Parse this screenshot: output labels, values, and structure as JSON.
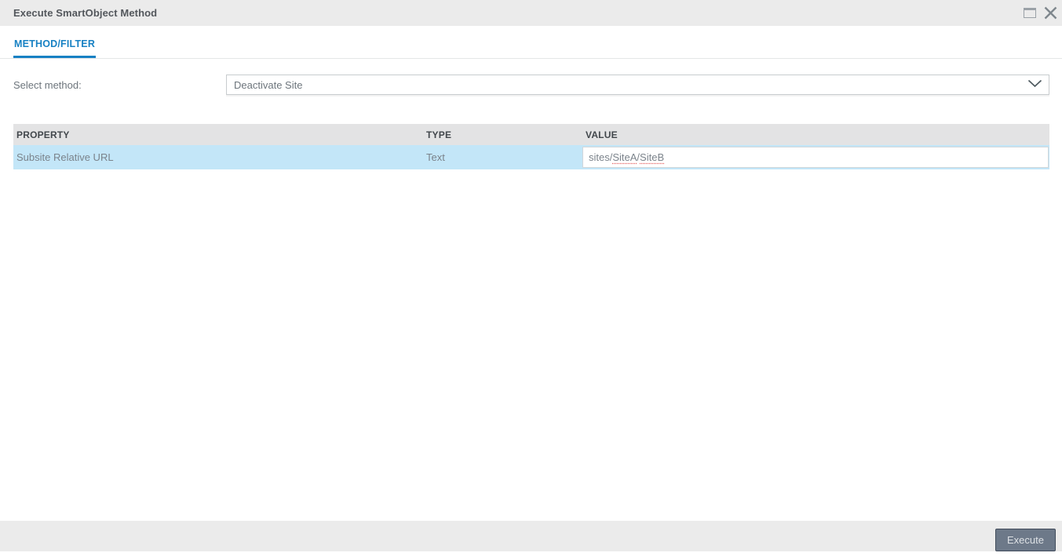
{
  "window": {
    "title": "Execute SmartObject Method"
  },
  "tabs": [
    {
      "label": "METHOD/FILTER",
      "active": true
    }
  ],
  "method_section": {
    "label": "Select method:",
    "selected_value": "Deactivate Site"
  },
  "table": {
    "columns": [
      "PROPERTY",
      "TYPE",
      "VALUE"
    ],
    "rows": [
      {
        "property": "Subsite Relative URL",
        "type": "Text",
        "value": "sites/SiteA/SiteB",
        "value_parts": {
          "p0": "sites/",
          "p1": "SiteA",
          "p2": "/",
          "p3": "SiteB"
        }
      }
    ]
  },
  "footer": {
    "execute_label": "Execute"
  },
  "icons": {
    "maximize": "maximize-window-icon",
    "close": "close-icon",
    "dropdown": "chevron-down-icon"
  },
  "colors": {
    "accent_blue": "#1781c3",
    "row_highlight": "#c3e6f8",
    "titlebar_bg": "#ebebeb",
    "header_bg": "#e3e3e4",
    "button_bg": "#6d7989",
    "button_border": "#414c5b",
    "spellcheck_red": "#e25555"
  }
}
